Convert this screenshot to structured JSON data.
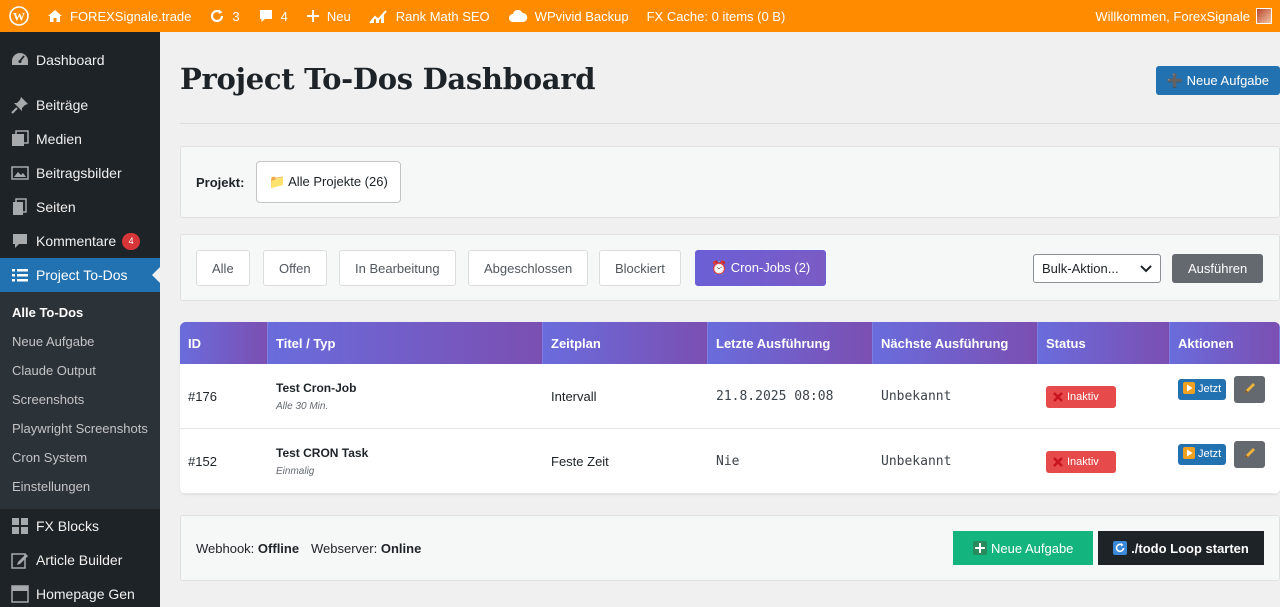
{
  "adminbar": {
    "site_name": "FOREXSignale.trade",
    "updates_count": "3",
    "comments_count": "4",
    "new_label": "Neu",
    "rankmath_label": "Rank Math SEO",
    "wpvivid_label": "WPvivid Backup",
    "fx_cache_label": "FX Cache: 0 items (0 B)",
    "welcome_label": "Willkommen, ForexSignale"
  },
  "sidebar": {
    "items": [
      {
        "label": "Dashboard",
        "icon": "dashboard-icon"
      },
      {
        "label": "Beiträge",
        "icon": "pin-icon"
      },
      {
        "label": "Medien",
        "icon": "media-icon"
      },
      {
        "label": "Beitragsbilder",
        "icon": "images-icon"
      },
      {
        "label": "Seiten",
        "icon": "pages-icon"
      },
      {
        "label": "Kommentare",
        "icon": "comment-icon",
        "badge": "4"
      },
      {
        "label": "Project To-Dos",
        "icon": "list-icon"
      },
      {
        "label": "FX Blocks",
        "icon": "grid-icon"
      },
      {
        "label": "Article Builder",
        "icon": "edit-icon"
      },
      {
        "label": "Homepage Gen",
        "icon": "layout-icon"
      }
    ],
    "submenu": [
      "Alle To-Dos",
      "Neue Aufgabe",
      "Claude Output",
      "Screenshots",
      "Playwright Screenshots",
      "Cron System",
      "Einstellungen"
    ]
  },
  "page": {
    "title": "Project To-Dos Dashboard",
    "new_task_label": "➕ Neue Aufgabe"
  },
  "project_filter": {
    "label": "Projekt:",
    "selected": "📁 Alle Projekte (26)"
  },
  "filters": {
    "tabs": [
      "Alle",
      "Offen",
      "In Bearbeitung",
      "Abgeschlossen",
      "Blockiert",
      "⏰ Cron-Jobs (2)"
    ],
    "active_index": 5,
    "bulk_select_value": "Bulk-Aktion...",
    "run_label": "Ausführen"
  },
  "table": {
    "columns": [
      "ID",
      "Titel / Typ",
      "Zeitplan",
      "Letzte Ausführung",
      "Nächste Ausführung",
      "Status",
      "Aktionen"
    ],
    "rows": [
      {
        "id": "#176",
        "title": "Test Cron-Job",
        "subtitle": "Alle 30 Min.",
        "schedule": "Intervall",
        "last_run": "21.8.2025 08:08",
        "next_run": "Unbekannt",
        "status": "Inaktiv",
        "run_label": "Jetzt"
      },
      {
        "id": "#152",
        "title": "Test CRON Task",
        "subtitle": "Einmalig",
        "schedule": "Feste Zeit",
        "last_run": "Nie",
        "next_run": "Unbekannt",
        "status": "Inaktiv",
        "run_label": "Jetzt"
      }
    ]
  },
  "footer": {
    "webhook_label": "Webhook:",
    "webhook_value": "Offline",
    "webserver_label": "Webserver:",
    "webserver_value": "Online",
    "new_task_label": "Neue Aufgabe",
    "loop_label": "./todo Loop starten"
  },
  "colors": {
    "adminbar": "#ff8c00",
    "sidebar": "#1d2327",
    "accent": "#2271b1",
    "table_header": "#6b65d6",
    "status_inactive": "#e64a4a",
    "green": "#14b47f"
  }
}
